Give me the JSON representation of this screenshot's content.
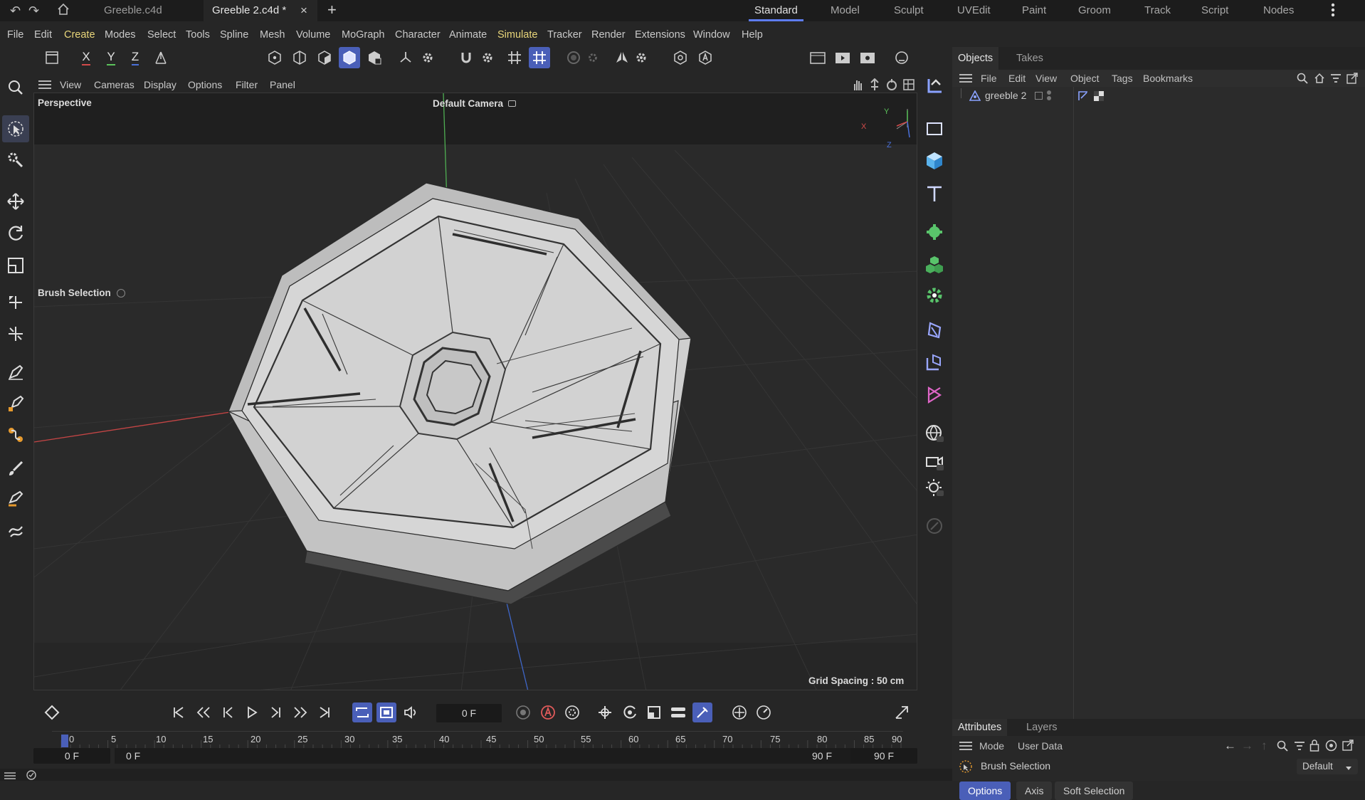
{
  "app": {
    "tabs": [
      {
        "label": "Greeble.c4d",
        "active": false
      },
      {
        "label": "Greeble 2.c4d *",
        "active": true
      }
    ],
    "close_glyph": "×",
    "new_tab_glyph": "+",
    "layouts": [
      "Standard",
      "Model",
      "Sculpt",
      "UVEdit",
      "Paint",
      "Groom",
      "Track",
      "Script",
      "Nodes"
    ],
    "active_layout": "Standard"
  },
  "menubar": [
    "File",
    "Edit",
    "Create",
    "Modes",
    "Select",
    "Tools",
    "Spline",
    "Mesh",
    "Volume",
    "MoGraph",
    "Character",
    "Animate",
    "Simulate",
    "Tracker",
    "Render",
    "Extensions",
    "Window",
    "Help"
  ],
  "menubar_highlighted": [
    "Create",
    "Simulate"
  ],
  "toolbar": {
    "axis_x": "X",
    "axis_y": "Y",
    "axis_z": "Z"
  },
  "viewport": {
    "menu": [
      "View",
      "Cameras",
      "Display",
      "Options",
      "Filter",
      "Panel"
    ],
    "view_name": "Perspective",
    "camera_label": "Default Camera",
    "tool_label": "Brush Selection",
    "grid_spacing": "Grid Spacing : 50 cm",
    "axis_labels": {
      "x": "X",
      "y": "Y",
      "z": "Z"
    }
  },
  "timeline": {
    "current_frame": "0 F",
    "start_field": "0 F",
    "range_start": "0 F",
    "range_end": "90 F",
    "end_field": "90 F",
    "ticks": [
      "0",
      "5",
      "10",
      "15",
      "20",
      "25",
      "30",
      "35",
      "40",
      "45",
      "50",
      "55",
      "60",
      "65",
      "70",
      "75",
      "80",
      "85",
      "90"
    ]
  },
  "objects_panel": {
    "tabs": [
      "Objects",
      "Takes"
    ],
    "menu": [
      "File",
      "Edit",
      "View",
      "Object",
      "Tags",
      "Bookmarks"
    ],
    "objects": [
      {
        "name": "greeble 2"
      }
    ]
  },
  "attributes_panel": {
    "tabs": [
      "Attributes",
      "Layers"
    ],
    "menu": [
      "Mode",
      "User Data"
    ],
    "tool_name": "Brush Selection",
    "preset": "Default",
    "subtabs": [
      {
        "label": "Options",
        "active": true
      },
      {
        "label": "Axis",
        "active": false
      },
      {
        "label": "Soft Selection",
        "active": false
      }
    ]
  },
  "colors": {
    "accent": "#4a5fb8",
    "menu_highlight": "#e9d67a",
    "axis_x": "#d24a4a",
    "axis_y": "#5bc35b",
    "axis_z": "#4a70d8",
    "green_icon": "#59c46b"
  },
  "icons": [
    "undo-icon",
    "redo-icon",
    "home-icon",
    "search-icon",
    "live-selection-icon",
    "move-icon",
    "rotate-icon",
    "scale-icon",
    "brush-icon",
    "camera-icon",
    "cube-icon",
    "text-icon",
    "gear-icon",
    "play-icon",
    "record-icon",
    "layer-icon"
  ]
}
